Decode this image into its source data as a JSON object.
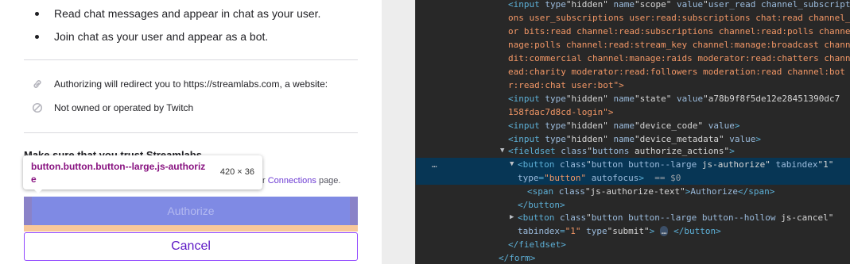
{
  "auth_page": {
    "permissions": [
      "Read chat messages and appear in chat as your user.",
      "Join chat as your user and appear as a bot."
    ],
    "redirect_note": "Authorizing will redirect you to https://streamlabs.com, a website:",
    "not_owned_note": "Not owned or operated by Twitch",
    "hidden_heading": "Make sure that you trust Streamlabs",
    "connections_prefix": "r ",
    "connections_link": "Connections",
    "connections_suffix": " page.",
    "authorize_label": "Authorize",
    "cancel_label": "Cancel"
  },
  "inspect_tooltip": {
    "selector": "button.button.button--large.js-authorize",
    "dimensions": "420 × 36"
  },
  "devtools": {
    "lines": [
      "<input type=\"hidden\" name=\"scope\" value=\"user_read channel_subscriptions",
      "ons user_subscriptions user:read:subscriptions chat:read channel_r",
      "or bits:read channel:read:subscriptions channel:read:polls channel",
      "nage:polls channel:read:stream_key channel:manage:broadcast channe",
      "dit:commercial channel:manage:raids moderator:read:chatters channe",
      "ead:charity moderator:read:followers moderation:read channel:bot u",
      "r:read:chat user:bot\">",
      "<input type=\"hidden\" name=\"state\" value=\"a78b9f8f5de12e28451390dc7",
      "158fdac7d8cd-login\">",
      "<input type=\"hidden\" name=\"device_code\" value>",
      "<input type=\"hidden\" name=\"device_metadata\" value>",
      "<fieldset class=\"buttons authorize_actions\">",
      "<button class=\"button button--large js-authorize\" tabindex=\"1\"",
      "type=\"button\" autofocus> == $0",
      "<span class=\"js-authorize-text\">Authorize</span>",
      "</button>",
      "<button class=\"button button--large button--hollow js-cancel\"",
      "tabindex=\"1\" type=\"submit\"> … </button>",
      "</fieldset>",
      "</form>"
    ],
    "gutter_dots": "…",
    "colors": {
      "background": "#282828",
      "selected_row": "#073655",
      "tag": "#5db0d7",
      "attr_name": "#9bbbdc",
      "attr_value": "#f29766"
    }
  },
  "colors": {
    "authorize_bg": "#7f8ae4",
    "cancel_border": "#9147ff",
    "tooltip_selector": "#881280",
    "padding_highlight": "#f8c89a"
  }
}
